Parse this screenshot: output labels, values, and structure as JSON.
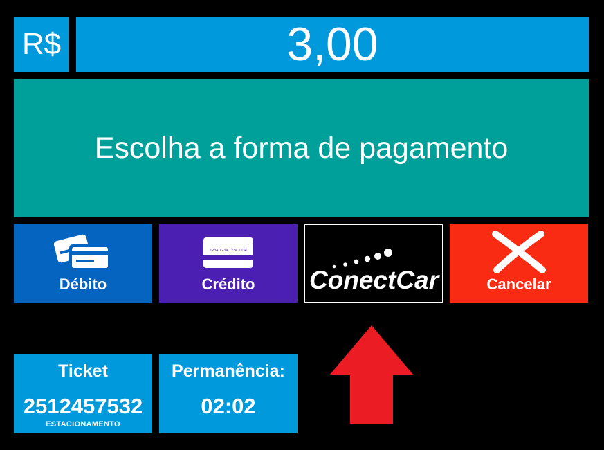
{
  "header": {
    "currency_symbol": "R$",
    "amount": "3,00"
  },
  "prompt": {
    "text": "Escolha a forma de pagamento"
  },
  "payment_options": {
    "debito": {
      "label": "Débito",
      "icon": "debit-cards-icon"
    },
    "credito": {
      "label": "Crédito",
      "icon": "credit-card-icon",
      "card_number": "1234 1234 1234 1234"
    },
    "conectcar": {
      "label": "ConectCar",
      "icon": "conectcar-logo"
    },
    "cancelar": {
      "label": "Cancelar",
      "icon": "close-icon"
    }
  },
  "info": {
    "ticket": {
      "title": "Ticket",
      "value": "2512457532",
      "subtitle": "ESTACIONAMENTO"
    },
    "permanencia": {
      "title": "Permanência:",
      "value": "02:02"
    }
  },
  "colors": {
    "background": "#000000",
    "header_blue": "#0099dc",
    "prompt_teal": "#00a09a",
    "debito_blue": "#0564c0",
    "credito_purple": "#4b1fb2",
    "cancel_red": "#fa2b13",
    "arrow_red": "#ec1c24"
  }
}
